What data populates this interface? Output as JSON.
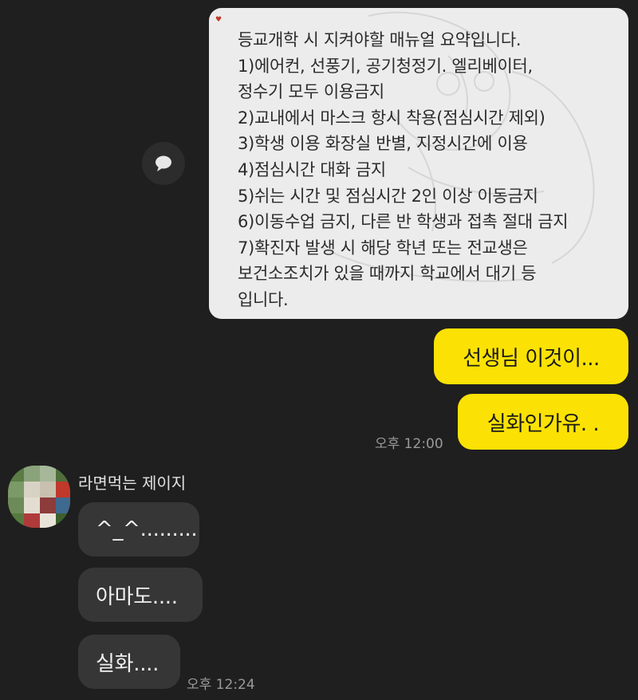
{
  "image_message": {
    "lines": [
      "등교개학 시 지켜야할 매뉴얼 요약입니다.",
      "1)에어컨, 선풍기, 공기청정기. 엘리베이터,",
      "정수기 모두 이용금지",
      "2)교내에서 마스크 항시 착용(점심시간 제외)",
      "3)학생 이용 화장실 반별, 지정시간에 이용",
      "4)점심시간 대화 금지",
      "5)쉬는 시간 및 점심시간 2인 이상 이동금지",
      "6)이동수업 금지, 다른 반 학생과 접촉 절대 금지",
      "7)확진자 발생 시 해당 학년 또는 전교생은",
      "보건소조치가 있을 때까지 학교에서 대기 등",
      "입니다."
    ]
  },
  "my_messages": [
    {
      "text": "선생님 이것이..."
    },
    {
      "text": "실화인가유.  ."
    }
  ],
  "my_time": "오후 12:00",
  "other": {
    "sender": "라면먹는 제이지",
    "messages": [
      {
        "text": "^_^........."
      },
      {
        "text": "아마도...."
      },
      {
        "text": "실화...."
      }
    ],
    "time": "오후 12:24"
  },
  "colors": {
    "background": "#1f1f1f",
    "my_bubble": "#fbe204",
    "other_bubble": "#363636"
  },
  "icons": {
    "share": "share-icon",
    "avatar": "pixelated-avatar"
  }
}
